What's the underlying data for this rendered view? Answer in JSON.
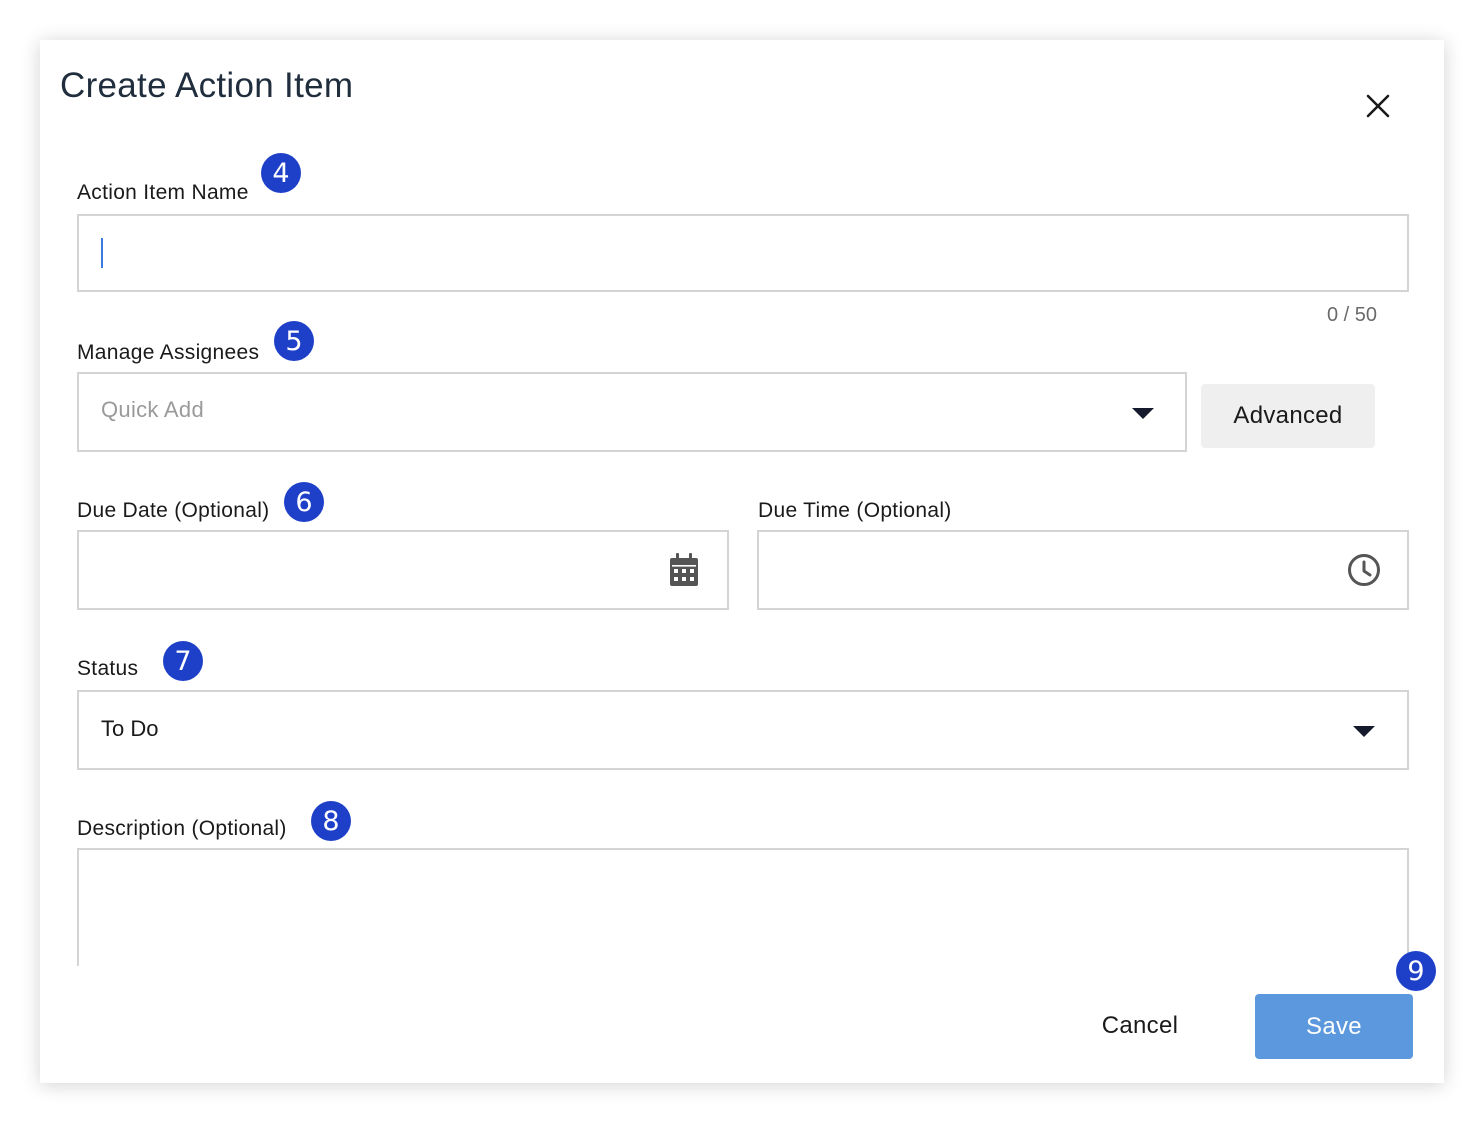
{
  "dialog": {
    "title": "Create Action Item",
    "close_icon": "close-icon"
  },
  "name_field": {
    "label": "Action Item Name",
    "value": "",
    "counter": "0 / 50",
    "badge": "4"
  },
  "assignees": {
    "label": "Manage Assignees",
    "placeholder": "Quick Add",
    "dropdown_icon": "caret-down-icon",
    "advanced_label": "Advanced",
    "badge": "5"
  },
  "due_date": {
    "label": "Due Date (Optional)",
    "value": "",
    "icon": "calendar-icon",
    "badge": "6"
  },
  "due_time": {
    "label": "Due Time (Optional)",
    "value": "",
    "icon": "clock-icon"
  },
  "status": {
    "label": "Status",
    "value": "To Do",
    "dropdown_icon": "caret-down-icon",
    "badge": "7"
  },
  "description": {
    "label": "Description (Optional)",
    "value": "",
    "badge": "8"
  },
  "footer": {
    "cancel_label": "Cancel",
    "save_label": "Save",
    "badge": "9"
  },
  "colors": {
    "badge": "#1e40c9",
    "save_button": "#5b98dd",
    "advanced_button": "#efefef",
    "field_border": "#d4d4d4",
    "title_text": "#1f2d3d"
  }
}
